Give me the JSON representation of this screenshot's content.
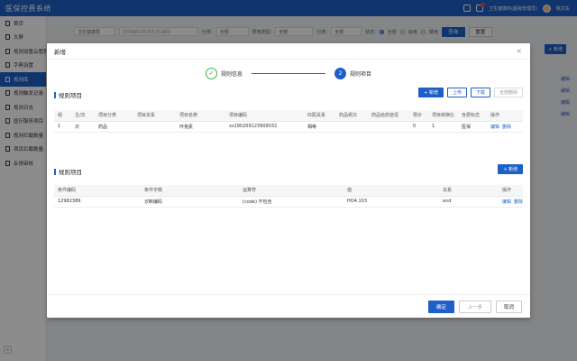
{
  "app": {
    "title": "医保控费系统",
    "user_org": "卫生健康的(超级管理员)",
    "user_name": "陈文东"
  },
  "sidebar": {
    "items": [
      {
        "label": "首页"
      },
      {
        "label": "大屏"
      },
      {
        "label": "规则设置云管理"
      },
      {
        "label": "字典设置"
      },
      {
        "label": "规则库"
      },
      {
        "label": "规则触发记录"
      },
      {
        "label": "规则日志"
      },
      {
        "label": "医疗服务项目"
      },
      {
        "label": "规则拦截数量"
      },
      {
        "label": "项目拦截数量"
      },
      {
        "label": "反馈审核"
      }
    ],
    "collapse": "<"
  },
  "filters": {
    "level_select": "卫生健康局",
    "search_placeholder": "规则编码/规则名称/编码",
    "category_label": "分类:",
    "category_value": "全部",
    "cost_type_label": "费用类型:",
    "cost_type_value": "全部",
    "category2_label": "分类:",
    "category2_value": "全部",
    "status_label": "状态:",
    "status_all": "全部",
    "status_enabled": "启用",
    "status_disabled": "禁用",
    "query": "查询",
    "reset": "重置",
    "add": "+ 新增"
  },
  "bg_links": [
    "编辑",
    "编辑",
    "编辑",
    "编辑"
  ],
  "modal": {
    "title": "新增",
    "close": "×",
    "steps": [
      {
        "index": "✓",
        "label": "规则信息"
      },
      {
        "index": "2",
        "label": "规则项目"
      }
    ],
    "section1": {
      "title": "规则项目",
      "buttons": {
        "add": "+ 新增",
        "upload": "上传",
        "download": "下载",
        "delete_all": "全部删除"
      },
      "columns": [
        "组",
        "主/次",
        "项目分类",
        "项目关系",
        "项目名称",
        "项目编码",
        "匹配关系",
        "药品频次",
        "药品给药途径",
        "限价",
        "项目转换比",
        "含费标志",
        "操作"
      ],
      "rows": [
        {
          "cells": [
            "1",
            "次",
            "药品",
            "",
            "环孢素",
            "xs190209123909032",
            "相等",
            "",
            "",
            "0",
            "1",
            "医保"
          ],
          "actions": [
            "编辑",
            "删除"
          ]
        }
      ]
    },
    "section2": {
      "title": "规则项目",
      "buttons": {
        "add": "+ 新增"
      },
      "columns": [
        "条件编码",
        "条件字典",
        "运算符",
        "值",
        "关系",
        "操作"
      ],
      "rows": [
        {
          "cells": [
            "12982389.",
            "诊断编码",
            "(code) 不包含",
            "HO4.103",
            "and"
          ],
          "actions": [
            "编辑",
            "删除"
          ]
        }
      ]
    },
    "footer": {
      "ok": "确定",
      "prev": "上一步",
      "cancel": "取消"
    }
  },
  "colors": {
    "primary": "#1e5fc8",
    "success": "#3bb44a",
    "badge": "#f04848"
  }
}
